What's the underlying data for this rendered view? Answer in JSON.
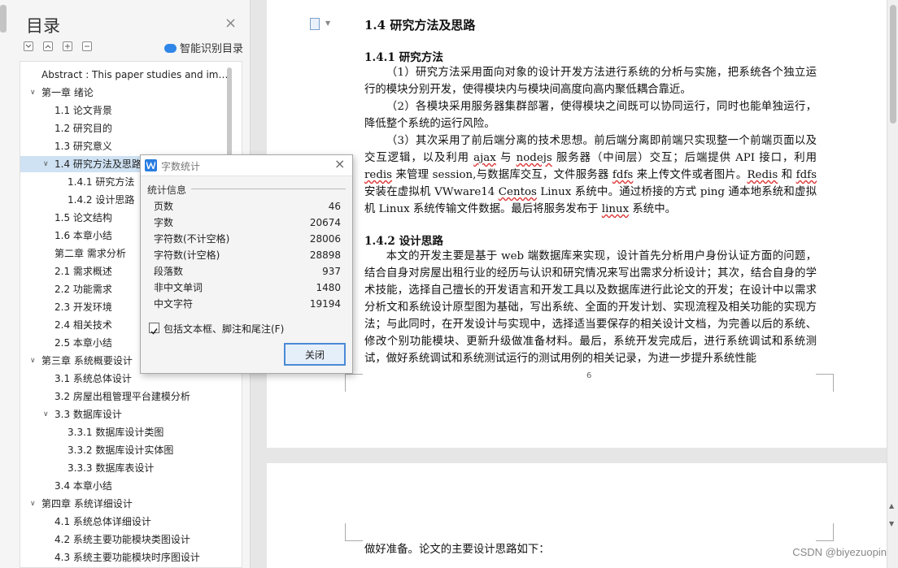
{
  "toc": {
    "title": "目录",
    "close_icon": "×",
    "smart_label": "智能识别目录",
    "items": [
      {
        "label": "Abstract : This paper studies and im…",
        "arrow": ""
      },
      {
        "label": "第一章  绪论",
        "arrow": "∨"
      },
      {
        "label": "1.1  论文背景",
        "arrow": ""
      },
      {
        "label": "1.2  研究目的",
        "arrow": ""
      },
      {
        "label": "1.3  研究意义",
        "arrow": ""
      },
      {
        "label": "1.4  研究方法及思路",
        "arrow": "∨"
      },
      {
        "label": "1.4.1  研究方法",
        "arrow": ""
      },
      {
        "label": "1.4.2  设计思路",
        "arrow": ""
      },
      {
        "label": "1.5  论文结构",
        "arrow": ""
      },
      {
        "label": "1.6  本章小结",
        "arrow": ""
      },
      {
        "label": "第二章  需求分析",
        "arrow": ""
      },
      {
        "label": "2.1  需求概述",
        "arrow": ""
      },
      {
        "label": "2.2  功能需求",
        "arrow": ""
      },
      {
        "label": "2.3  开发环境",
        "arrow": ""
      },
      {
        "label": "2.4  相关技术",
        "arrow": ""
      },
      {
        "label": "2.5  本章小结",
        "arrow": ""
      },
      {
        "label": "第三章  系统概要设计",
        "arrow": "∨"
      },
      {
        "label": "3.1  系统总体设计",
        "arrow": ""
      },
      {
        "label": "3.2  房屋出租管理平台建模分析",
        "arrow": ""
      },
      {
        "label": "3.3 数据库设计",
        "arrow": "∨"
      },
      {
        "label": "3.3.1  数据库设计类图",
        "arrow": ""
      },
      {
        "label": "3.3.2  数据库设计实体图",
        "arrow": ""
      },
      {
        "label": "3.3.3  数据库表设计",
        "arrow": ""
      },
      {
        "label": "3.4  本章小结",
        "arrow": ""
      },
      {
        "label": "第四章  系统详细设计",
        "arrow": "∨"
      },
      {
        "label": "4.1  系统总体详细设计",
        "arrow": ""
      },
      {
        "label": "4.2  系统主要功能模块类图设计",
        "arrow": ""
      },
      {
        "label": "4.3  系统主要功能模块时序图设计",
        "arrow": ""
      }
    ]
  },
  "document": {
    "h1": "1.4  研究方法及思路",
    "h2_method": "1.4.1  研究方法",
    "p1": "（1）研究方法采用面向对象的设计开发方法进行系统的分析与实施，把系统各个独立运行的模块分别开发，使得模块内与模块间高度向高内聚低耦合靠近。",
    "p2": "（2）各模块采用服务器集群部署，使得模块之间既可以协同运行，同时也能单独运行，降低整个系统的运行风险。",
    "p3": {
      "t1": "（3）其次采用了前后端分离的技术思想。前后端分离即前端只实现整一个前端页面以及交互逻辑，以及利用 ",
      "ajax": "ajax",
      "t2": " 与 ",
      "nodejs": "nodejs",
      "t3": " 服务器（中间层）交互；后端提供 API 接口，利用 ",
      "redis": "redis",
      "t4": " 来管理 session,与数据库交互，文件服务器 ",
      "fdfs1": "fdfs",
      "t5": " 来上传文件或者图片。",
      "Redis": "Redis",
      "t6": " 和 ",
      "fdfs2": "fdfs",
      "t7": " 安装在虚拟机 VWware14 ",
      "Centos": "Centos",
      "t8": " Linux 系统中。通过桥接的方式 ping 通本地系统和虚拟机 Linux 系统传输文件数据。最后将服务发布于 ",
      "linux": "linux",
      "t9": " 系统中。"
    },
    "h2_design": "1.4.2  设计思路",
    "p4": "本文的开发主要是基于 web 端数据库来实现，设计首先分析用户身份认证方面的问题，结合自身对房屋出租行业的经历与认识和研究情况来写出需求分析设计；其次，结合自身的学术技能，选择自己擅长的开发语言和开发工具以及数据库进行此论文的开发；在设计中以需求分析文和系统设计原型图为基础，写出系统、全面的开发计划、实现流程及相关功能的实现方法；与此同时，在开发设计与实现中，选择适当要保存的相关设计文档，为完善以后的系统、修改个别功能模块、更新升级做准备材料。最后，系统开发完成后，进行系统调试和系统测试，做好系统调试和系统测试运行的测试用例的相关记录，为进一步提升系统性能",
    "page_number": "6",
    "page2_text": "做好准备。论文的主要设计思路如下："
  },
  "dialog": {
    "title": "字数统计",
    "close_icon": "×",
    "section": "统计信息",
    "rows": [
      {
        "label": "页数",
        "value": "46"
      },
      {
        "label": "字数",
        "value": "20674"
      },
      {
        "label": "字符数(不计空格)",
        "value": "28006"
      },
      {
        "label": "字符数(计空格)",
        "value": "28898"
      },
      {
        "label": "段落数",
        "value": "937"
      },
      {
        "label": "非中文单词",
        "value": "1480"
      },
      {
        "label": "中文字符",
        "value": "19194"
      }
    ],
    "checkbox_label": "包括文本框、脚注和尾注(F)",
    "checkbox_checked": true,
    "close_button": "关闭"
  },
  "watermark": "CSDN @biyezuopin",
  "colors": {
    "accent": "#2a7de1",
    "selection": "#cfe2f3"
  }
}
